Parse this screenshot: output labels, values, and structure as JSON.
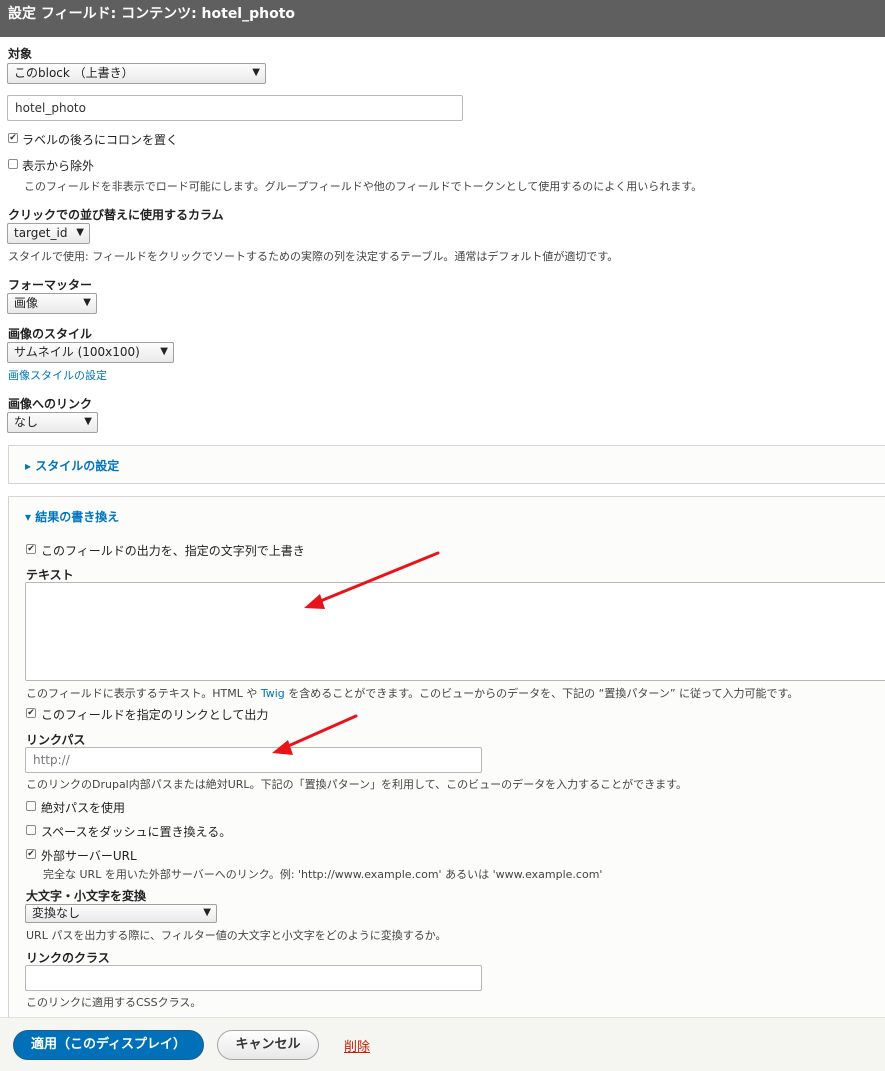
{
  "title": "設定 フィールド: コンテンツ: hotel_photo",
  "target": {
    "label": "対象",
    "value": "このblock （上書き）"
  },
  "label_field": {
    "value": "hotel_photo"
  },
  "colon_checkbox": {
    "label": "ラベルの後ろにコロンを置く",
    "checked": true
  },
  "exclude_checkbox": {
    "label": "表示から除外",
    "checked": false,
    "description": "このフィールドを非表示でロード可能にします。グループフィールドや他のフィールドでトークンとして使用するのによく用いられます。"
  },
  "click_sort": {
    "label": "クリックでの並び替えに使用するカラム",
    "value": "target_id",
    "description": "スタイルで使用: フィールドをクリックでソートするための実際の列を決定するテーブル。通常はデフォルト値が適切です。"
  },
  "formatter": {
    "label": "フォーマッター",
    "value": "画像"
  },
  "image_style": {
    "label": "画像のスタイル",
    "value": "サムネイル (100x100)",
    "link_text": "画像スタイルの設定"
  },
  "image_link": {
    "label": "画像へのリンク",
    "value": "なし"
  },
  "style_settings": {
    "summary": "▸ スタイルの設定"
  },
  "rewrite": {
    "summary": "▾ 結果の書き換え",
    "override_checkbox": {
      "label": "このフィールドの出力を、指定の文字列で上書き",
      "checked": true
    },
    "text_label": "テキスト",
    "text_desc_pre": "このフィールドに表示するテキスト。HTML や ",
    "text_desc_link": "Twig",
    "text_desc_post": " を含めることができます。このビューからのデータを、下記の “置換パターン” に従って入力可能です。",
    "link_checkbox": {
      "label": "このフィールドを指定のリンクとして出力",
      "checked": true
    },
    "link_path_label": "リンクパス",
    "link_path_value": "http://",
    "link_path_desc": "このリンクのDrupal内部パスまたは絶対URL。下記の「置換パターン」を利用して、このビューのデータを入力することができます。",
    "absolute_checkbox": {
      "label": "絶対パスを使用",
      "checked": false
    },
    "dash_checkbox": {
      "label": "スペースをダッシュに置き換える。",
      "checked": false
    },
    "external_checkbox": {
      "label": "外部サーバーURL",
      "checked": true,
      "description": "完全な URL を用いた外部サーバーへのリンク。例: 'http://www.example.com' あるいは 'www.example.com'"
    },
    "case_label": "大文字・小文字を変換",
    "case_value": "変換なし",
    "case_desc": "URL パスを出力する際に、フィルター値の大文字と小文字をどのように変換するか。",
    "link_class_label": "リンクのクラス",
    "link_class_desc": "このリンクに適用するCSSクラス。"
  },
  "buttons": {
    "apply": "適用（このディスプレイ）",
    "cancel": "キャンセル",
    "delete": "削除"
  },
  "check_glyph": "✔",
  "arrow_glyph": "▼",
  "colors": {
    "header": "#5f5f5f",
    "link": "#0074bd",
    "primary": "#0071b8",
    "annotation_arrow": "#e8141a",
    "delete": "#c72100"
  }
}
